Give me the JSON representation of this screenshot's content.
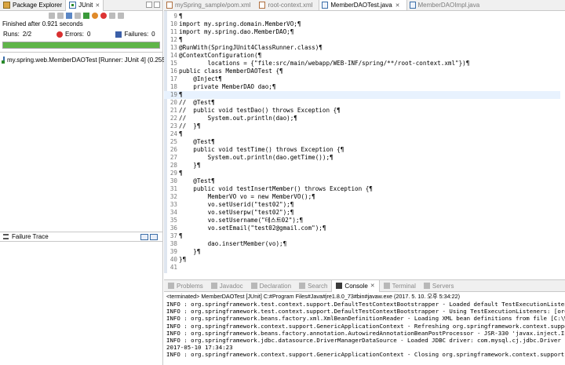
{
  "left_view": {
    "tabs": [
      {
        "label": "Package Explorer",
        "icon": "package-icon"
      },
      {
        "label": "JUnit",
        "icon": "junit-icon",
        "active": true
      }
    ],
    "finished_text": "Finished after 0.921 seconds",
    "runs_label": "Runs:",
    "runs_value": "2/2",
    "errors_label": "Errors:",
    "errors_value": "0",
    "failures_label": "Failures:",
    "failures_value": "0",
    "progress_fraction": 1.0,
    "progress_color": "#5fb548",
    "test_item": "my.spring.web.MemberDAOTest [Runner: JUnit 4] (0.255 s)",
    "failure_trace_label": "Failure Trace"
  },
  "editor": {
    "tabs": [
      {
        "label": "mySpring_sample/pom.xml",
        "type": "xml"
      },
      {
        "label": "root-context.xml",
        "type": "xml"
      },
      {
        "label": "MemberDAOTest.java",
        "type": "java",
        "active": true
      },
      {
        "label": "MemberDAOImpl.java",
        "type": "java"
      }
    ],
    "lines": [
      {
        "n": "9",
        "text": "¶"
      },
      {
        "n": "10",
        "text": "import my.spring.domain.MemberVO;¶"
      },
      {
        "n": "11",
        "text": "import my.spring.dao.MemberDAO;¶"
      },
      {
        "n": "12",
        "text": "¶"
      },
      {
        "n": "13",
        "text": "@RunWith(SpringJUnit4ClassRunner.class)¶"
      },
      {
        "n": "14",
        "text": "@ContextConfiguration(¶"
      },
      {
        "n": "15",
        "text": "        locations = {\"file:src/main/webapp/WEB-INF/spring/**/root-context.xml\"})¶"
      },
      {
        "n": "16",
        "text": "public class MemberDAOTest {¶"
      },
      {
        "n": "17",
        "text": "    @Inject¶"
      },
      {
        "n": "18",
        "text": "    private MemberDAO dao;¶"
      },
      {
        "n": "19",
        "text": "¶",
        "highlight": true
      },
      {
        "n": "20",
        "text": "//  @Test¶"
      },
      {
        "n": "21",
        "text": "//  public void testDao() throws Exception {¶"
      },
      {
        "n": "22",
        "text": "//      System.out.println(dao);¶"
      },
      {
        "n": "23",
        "text": "//  }¶"
      },
      {
        "n": "24",
        "text": "¶"
      },
      {
        "n": "25",
        "text": "    @Test¶"
      },
      {
        "n": "26",
        "text": "    public void testTime() throws Exception {¶"
      },
      {
        "n": "27",
        "text": "        System.out.println(dao.getTime());¶"
      },
      {
        "n": "28",
        "text": "    }¶"
      },
      {
        "n": "29",
        "text": "¶"
      },
      {
        "n": "30",
        "text": "    @Test¶"
      },
      {
        "n": "31",
        "text": "    public void testInsertMember() throws Exception {¶"
      },
      {
        "n": "32",
        "text": "        MemberVO vo = new MemberVO();¶"
      },
      {
        "n": "33",
        "text": "        vo.setUserid(\"test02\");¶"
      },
      {
        "n": "34",
        "text": "        vo.setUserpw(\"test02\");¶"
      },
      {
        "n": "35",
        "text": "        vo.setUsername(\"테스트02\");¶"
      },
      {
        "n": "36",
        "text": "        vo.setEmail(\"test02@gmail.com\");¶"
      },
      {
        "n": "37",
        "text": "¶"
      },
      {
        "n": "38",
        "text": "        dao.insertMember(vo);¶"
      },
      {
        "n": "39",
        "text": "    }¶"
      },
      {
        "n": "40",
        "text": "}¶"
      },
      {
        "n": "41",
        "text": ""
      }
    ]
  },
  "bottom_view": {
    "tabs": [
      {
        "label": "Problems"
      },
      {
        "label": "Javadoc"
      },
      {
        "label": "Declaration"
      },
      {
        "label": "Search"
      },
      {
        "label": "Console",
        "active": true
      },
      {
        "label": "Terminal"
      },
      {
        "label": "Servers"
      }
    ],
    "terminated_line": "<terminated> MemberDAOTest [JUnit] C:#Program Files#Java#jre1.8.0_73#bin#javaw.exe (2017. 5. 10. 오후 5:34:22)",
    "console_lines": [
      "INFO : org.springframework.test.context.support.DefaultTestContextBootstrapper - Loaded default TestExecutionListener",
      "INFO : org.springframework.test.context.support.DefaultTestContextBootstrapper - Using TestExecutionListeners: [org",
      "INFO : org.springframework.beans.factory.xml.XmlBeanDefinitionReader - Loading XML bean definitions from file [C:\\W",
      "INFO : org.springframework.context.support.GenericApplicationContext - Refreshing org.springframework.context.suppo",
      "INFO : org.springframework.beans.factory.annotation.AutowiredAnnotationBeanPostProcessor - JSR-330 'javax.inject.In",
      "INFO : org.springframework.jdbc.datasource.DriverManagerDataSource - Loaded JDBC driver: com.mysql.cj.jdbc.Driver",
      "2017-05-10 17:34:23",
      "INFO : org.springframework.context.support.GenericApplicationContext - Closing org.springframework.context.support."
    ]
  }
}
